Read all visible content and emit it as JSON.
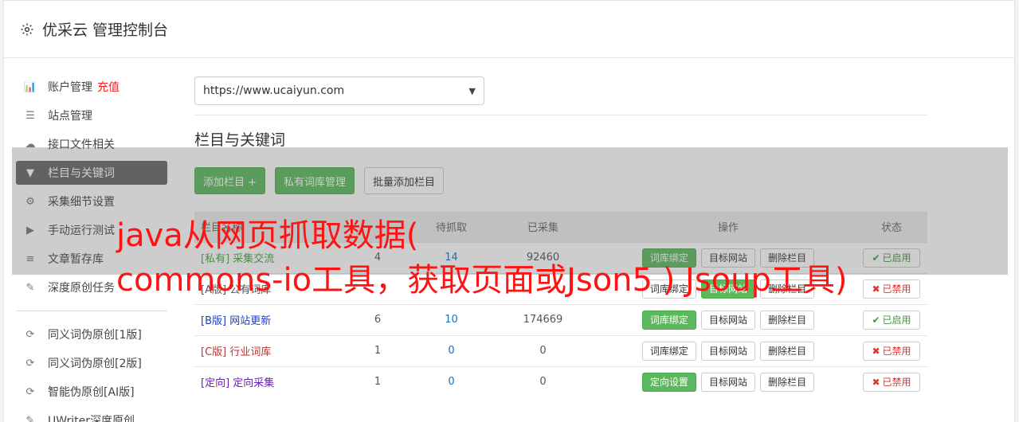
{
  "header": {
    "title": "优采云 管理控制台",
    "icon": "gear-icon"
  },
  "sidebar": {
    "items": [
      {
        "label": "账户管理",
        "badge": "充值",
        "icon": "bar-chart-icon",
        "glyph": "📊"
      },
      {
        "label": "站点管理",
        "icon": "server-icon",
        "glyph": "☰"
      },
      {
        "label": "接口文件相关",
        "icon": "cloud-upload-icon",
        "glyph": "☁"
      },
      {
        "label": "栏目与关键词",
        "icon": "filter-icon",
        "glyph": "▼",
        "active": true
      },
      {
        "label": "采集细节设置",
        "icon": "cogs-icon",
        "glyph": "⚙"
      },
      {
        "label": "手动运行测试",
        "icon": "play-icon",
        "glyph": "▶"
      },
      {
        "label": "文章暂存库",
        "icon": "database-icon",
        "glyph": "≡"
      },
      {
        "label": "深度原创任务",
        "icon": "edit-icon",
        "glyph": "✎"
      }
    ],
    "items2": [
      {
        "label": "同义词伪原创[1版]",
        "icon": "refresh-icon",
        "glyph": "⟳"
      },
      {
        "label": "同义词伪原创[2版]",
        "icon": "refresh-icon",
        "glyph": "⟳"
      },
      {
        "label": "智能伪原创[AI版]",
        "icon": "refresh-icon",
        "glyph": "⟳"
      },
      {
        "label": "UWriter深度原创",
        "icon": "edit-icon",
        "glyph": "✎"
      }
    ]
  },
  "main": {
    "site_select": "https://www.ucaiyun.com",
    "section_title": "栏目与关键词",
    "buttons": {
      "add": "添加栏目 +",
      "private": "私有词库管理",
      "batch": "批量添加栏目"
    },
    "table": {
      "headers": [
        "栏目名称",
        "",
        "待抓取",
        "已采集",
        "操作",
        "状态"
      ],
      "rows": [
        {
          "tag": "[私有]",
          "name": "采集交流",
          "tag_color": "green",
          "a": "4",
          "b": "14",
          "c": "92460",
          "op1": "词库绑定",
          "op1_green": true,
          "op2": "目标网站",
          "op2_green": false,
          "op3": "删除栏目",
          "status": "已启用",
          "on": true
        },
        {
          "tag": "[A版]",
          "name": "公有词库",
          "tag_color": "default",
          "a": "",
          "b": "",
          "c": "",
          "op1": "词库绑定",
          "op1_green": false,
          "op2": "目标网站",
          "op2_green": true,
          "op3": "删除栏目",
          "status": "已禁用",
          "on": false
        },
        {
          "tag": "[B版]",
          "name": "网站更新",
          "tag_color": "blue",
          "a": "6",
          "b": "10",
          "c": "174669",
          "op1": "词库绑定",
          "op1_green": true,
          "op2": "目标网站",
          "op2_green": false,
          "op3": "删除栏目",
          "status": "已启用",
          "on": true
        },
        {
          "tag": "[C版]",
          "name": "行业词库",
          "tag_color": "red",
          "a": "1",
          "b": "0",
          "c": "0",
          "op1": "词库绑定",
          "op1_green": false,
          "op2": "目标网站",
          "op2_green": false,
          "op3": "删除栏目",
          "status": "已禁用",
          "on": false
        },
        {
          "tag": "[定向]",
          "name": "定向采集",
          "tag_color": "purple",
          "a": "1",
          "b": "0",
          "c": "0",
          "op1": "定向设置",
          "op1_green": true,
          "op2": "目标网站",
          "op2_green": false,
          "op3": "删除栏目",
          "status": "已禁用",
          "on": false
        }
      ]
    }
  },
  "banner": {
    "line1": "java从网页抓取数据(",
    "line2": "commons-io工具，获取页面或Json5 ) Jsoup工具)"
  }
}
